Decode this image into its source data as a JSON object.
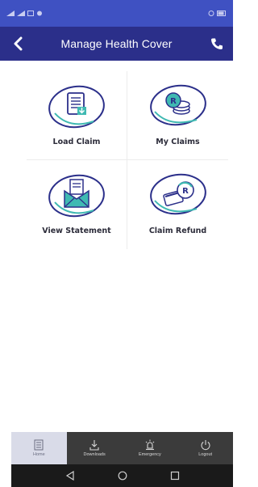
{
  "header": {
    "title": "Manage Health Cover",
    "back_icon": "chevron-left-icon",
    "call_icon": "phone-icon"
  },
  "tiles": [
    {
      "label": "Load Claim",
      "icon": "claim-document-icon"
    },
    {
      "label": "My Claims",
      "icon": "rand-coins-icon"
    },
    {
      "label": "View Statement",
      "icon": "envelope-statement-icon"
    },
    {
      "label": "Claim Refund",
      "icon": "card-refund-icon"
    }
  ],
  "bottom_nav": [
    {
      "label": "Home",
      "icon": "home-list-icon",
      "active": true
    },
    {
      "label": "Downloads",
      "icon": "download-icon",
      "active": false
    },
    {
      "label": "Emergency",
      "icon": "siren-icon",
      "active": false
    },
    {
      "label": "Logout",
      "icon": "power-icon",
      "active": false
    }
  ],
  "colors": {
    "status_bar": "#3f51c2",
    "app_bar": "#2b2f8a",
    "icon_teal": "#3fb9b2",
    "icon_navy": "#2b2f8a",
    "bottom_nav": "#3b3b3b"
  }
}
